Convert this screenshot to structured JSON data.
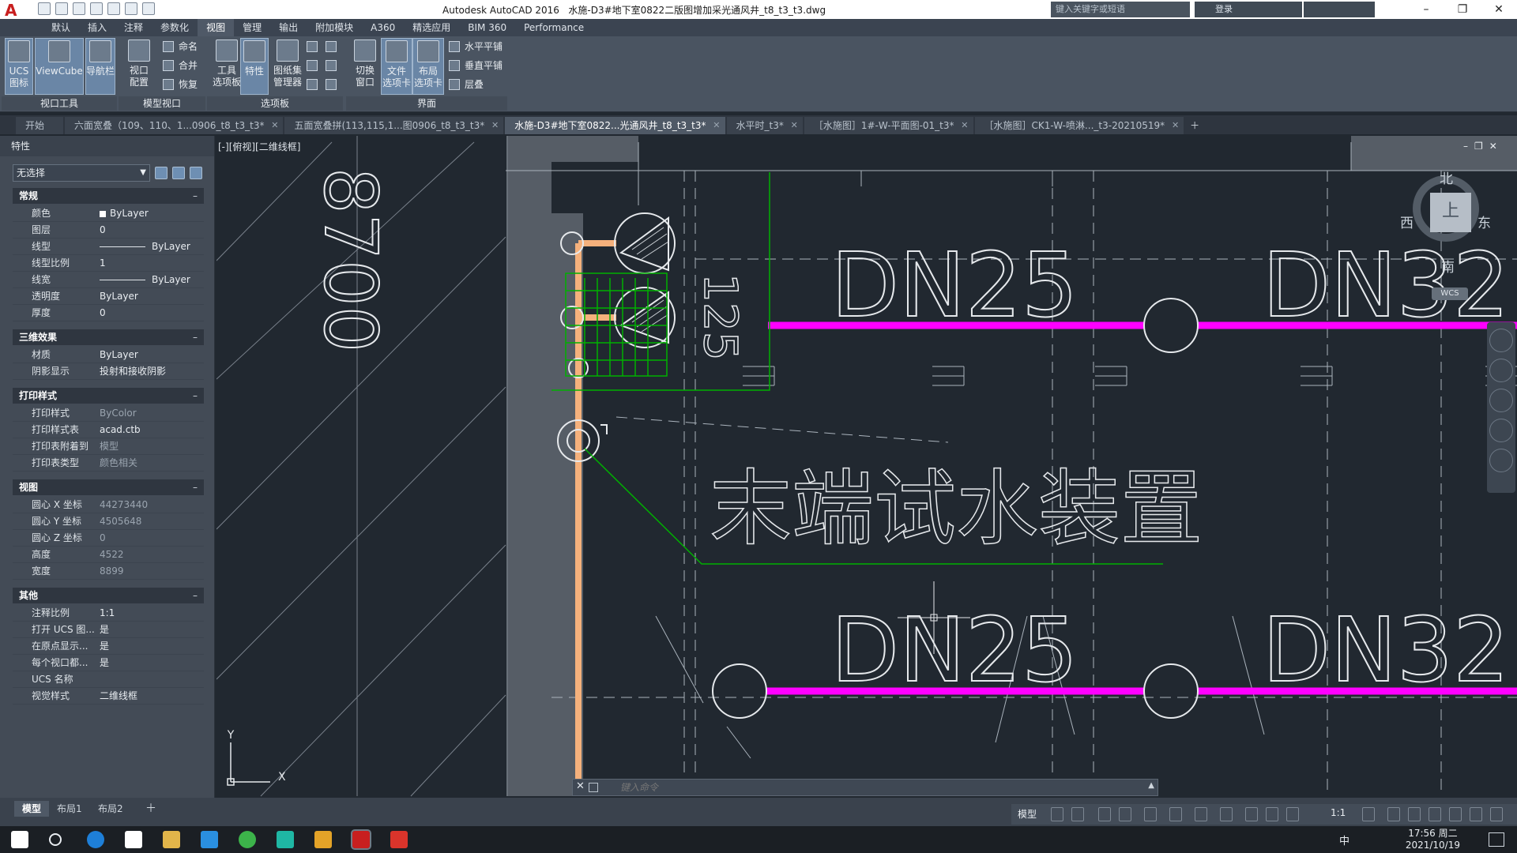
{
  "titlebar": {
    "app": "Autodesk AutoCAD 2016",
    "file": "水施-D3#地下室0822二版图增加采光通风井_t8_t3_t3.dwg",
    "search_placeholder": "键入关键字或短语",
    "login": "登录"
  },
  "ribbon_tabs": [
    "默认",
    "插入",
    "注释",
    "参数化",
    "视图",
    "管理",
    "输出",
    "附加模块",
    "A360",
    "精选应用",
    "BIM 360",
    "Performance"
  ],
  "ribbon_active_tab": "视图",
  "ribbon": {
    "viewport_tools": {
      "ucs": "UCS\n图标",
      "viewcube": "ViewCube",
      "navbar": "导航栏",
      "label": "视口工具"
    },
    "model_viewports": {
      "config": "视口\n配置",
      "name": "命名",
      "join": "合并",
      "restore": "恢复",
      "label": "模型视口"
    },
    "palettes": {
      "tool_palettes": "工具\n选项板",
      "properties": "特性",
      "sheet_set": "图纸集\n管理器",
      "label": "选项板"
    },
    "interface": {
      "switch_window": "切换\n窗口",
      "file_tabs": "文件\n选项卡",
      "layout_tabs": "布局\n选项卡",
      "tile_h": "水平平铺",
      "tile_v": "垂直平铺",
      "cascade": "层叠",
      "label": "界面"
    }
  },
  "file_tabs": [
    {
      "label": "开始",
      "active": false,
      "close": false
    },
    {
      "label": "六面宽叠（109、110、1...0906_t8_t3_t3*",
      "active": false,
      "close": true
    },
    {
      "label": "五面宽叠拼(113,115,1...图0906_t8_t3_t3*",
      "active": false,
      "close": true
    },
    {
      "label": "水施-D3#地下室0822...光通风井_t8_t3_t3*",
      "active": true,
      "close": true
    },
    {
      "label": "水平时_t3*",
      "active": false,
      "close": true
    },
    {
      "label": "［水施图］1#-W-平面图-01_t3*",
      "active": false,
      "close": true
    },
    {
      "label": "［水施图］CK1-W-喷淋..._t3-20210519*",
      "active": false,
      "close": true
    }
  ],
  "properties": {
    "title": "特性",
    "selection": "无选择",
    "sections": [
      {
        "name": "常规",
        "rows": [
          {
            "k": "颜色",
            "v": "ByLayer",
            "style": "swatch"
          },
          {
            "k": "图层",
            "v": "0"
          },
          {
            "k": "线型",
            "v": "ByLayer",
            "style": "line"
          },
          {
            "k": "线型比例",
            "v": "1"
          },
          {
            "k": "线宽",
            "v": "ByLayer",
            "style": "line"
          },
          {
            "k": "透明度",
            "v": "ByLayer"
          },
          {
            "k": "厚度",
            "v": "0"
          }
        ]
      },
      {
        "name": "三维效果",
        "rows": [
          {
            "k": "材质",
            "v": "ByLayer"
          },
          {
            "k": "阴影显示",
            "v": "投射和接收阴影"
          }
        ]
      },
      {
        "name": "打印样式",
        "rows": [
          {
            "k": "打印样式",
            "v": "ByColor",
            "style": "dim"
          },
          {
            "k": "打印样式表",
            "v": "acad.ctb"
          },
          {
            "k": "打印表附着到",
            "v": "模型",
            "style": "dim"
          },
          {
            "k": "打印表类型",
            "v": "颜色相关",
            "style": "dim"
          }
        ]
      },
      {
        "name": "视图",
        "rows": [
          {
            "k": "圆心 X 坐标",
            "v": "44273440",
            "style": "dim"
          },
          {
            "k": "圆心 Y 坐标",
            "v": "4505648",
            "style": "dim"
          },
          {
            "k": "圆心 Z 坐标",
            "v": "0",
            "style": "dim"
          },
          {
            "k": "高度",
            "v": "4522",
            "style": "dim"
          },
          {
            "k": "宽度",
            "v": "8899",
            "style": "dim"
          }
        ]
      },
      {
        "name": "其他",
        "rows": [
          {
            "k": "注释比例",
            "v": "1:1"
          },
          {
            "k": "打开 UCS 图...",
            "v": "是"
          },
          {
            "k": "在原点显示...",
            "v": "是"
          },
          {
            "k": "每个视口都...",
            "v": "是"
          },
          {
            "k": "UCS 名称",
            "v": ""
          },
          {
            "k": "视觉样式",
            "v": "二维线框"
          }
        ]
      }
    ]
  },
  "viewport": {
    "label": "[-][俯视][二维线框]",
    "viewcube": {
      "north": "北",
      "south": "南",
      "east": "东",
      "west": "西",
      "face": "上",
      "wcs": "WCS"
    }
  },
  "drawing": {
    "labels": {
      "dn25_top": "DN25",
      "dn32_top": "DN32",
      "dn25_bottom": "DN25",
      "dn32_bottom": "DN32",
      "note": "末端试水装置",
      "dim_8700": "8700",
      "num_125": "125"
    },
    "colors": {
      "pipe": "#ff00ff",
      "riser": "#f5b17c",
      "annot": "#00b000",
      "line": "#d8dde2"
    }
  },
  "command": {
    "placeholder": "键入命令"
  },
  "layout_tabs": [
    "模型",
    "布局1",
    "布局2"
  ],
  "status": {
    "model": "模型",
    "scale": "1:1"
  },
  "taskbar": {
    "lang": "中",
    "time": "17:56 周二",
    "date": "2021/10/19"
  }
}
